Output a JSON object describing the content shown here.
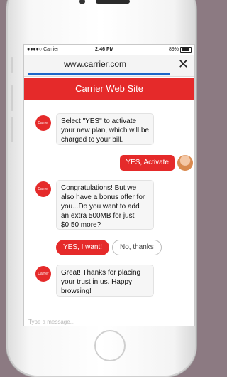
{
  "status": {
    "carrier": "●●●●○ Carrier",
    "time": "2:46 PM",
    "battery": "89%"
  },
  "browser": {
    "url": "www.carrier.com",
    "close_label": "✕"
  },
  "header": {
    "title": "Carrier Web Site"
  },
  "bot": {
    "avatar_label": "Carrier"
  },
  "messages": [
    {
      "from": "bot",
      "text": "Select \"YES\" to activate your new plan, which will be charged to your bill."
    },
    {
      "from": "user",
      "text": "YES, Activate"
    },
    {
      "from": "bot",
      "text": "Congratulations! But we also have a bonus offer for you...Do you want to add an extra 500MB for just $0.50 more?"
    },
    {
      "from": "bot",
      "text": "Great! Thanks for placing your trust in us. Happy browsing!"
    }
  ],
  "quick_replies": {
    "yes": "YES, I want!",
    "no": "No, thanks"
  },
  "composer": {
    "placeholder": "Type a message..."
  },
  "colors": {
    "brand": "#e52a2a",
    "background": "#8c7a82"
  }
}
